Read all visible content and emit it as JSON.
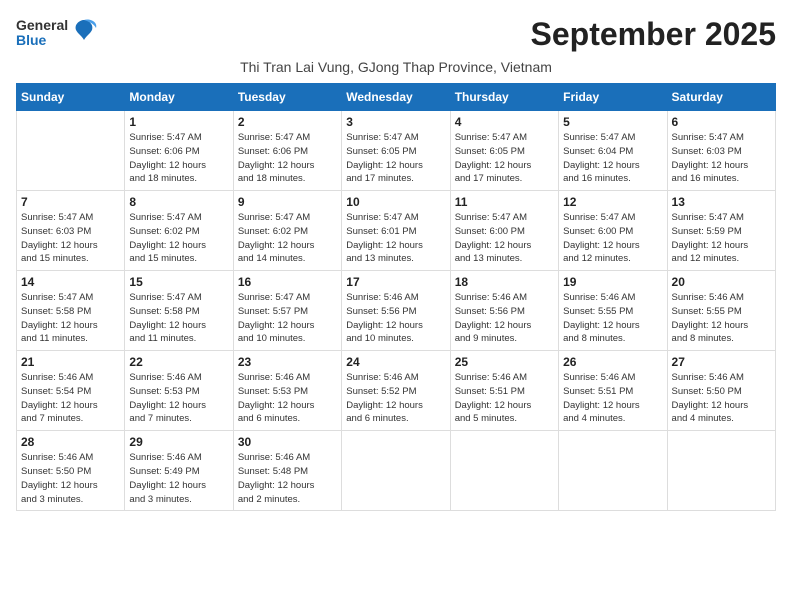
{
  "logo": {
    "general": "General",
    "blue": "Blue"
  },
  "title": "September 2025",
  "subtitle": "Thi Tran Lai Vung, GJong Thap Province, Vietnam",
  "headers": [
    "Sunday",
    "Monday",
    "Tuesday",
    "Wednesday",
    "Thursday",
    "Friday",
    "Saturday"
  ],
  "weeks": [
    [
      {
        "day": "",
        "info": ""
      },
      {
        "day": "1",
        "info": "Sunrise: 5:47 AM\nSunset: 6:06 PM\nDaylight: 12 hours\nand 18 minutes."
      },
      {
        "day": "2",
        "info": "Sunrise: 5:47 AM\nSunset: 6:06 PM\nDaylight: 12 hours\nand 18 minutes."
      },
      {
        "day": "3",
        "info": "Sunrise: 5:47 AM\nSunset: 6:05 PM\nDaylight: 12 hours\nand 17 minutes."
      },
      {
        "day": "4",
        "info": "Sunrise: 5:47 AM\nSunset: 6:05 PM\nDaylight: 12 hours\nand 17 minutes."
      },
      {
        "day": "5",
        "info": "Sunrise: 5:47 AM\nSunset: 6:04 PM\nDaylight: 12 hours\nand 16 minutes."
      },
      {
        "day": "6",
        "info": "Sunrise: 5:47 AM\nSunset: 6:03 PM\nDaylight: 12 hours\nand 16 minutes."
      }
    ],
    [
      {
        "day": "7",
        "info": "Sunrise: 5:47 AM\nSunset: 6:03 PM\nDaylight: 12 hours\nand 15 minutes."
      },
      {
        "day": "8",
        "info": "Sunrise: 5:47 AM\nSunset: 6:02 PM\nDaylight: 12 hours\nand 15 minutes."
      },
      {
        "day": "9",
        "info": "Sunrise: 5:47 AM\nSunset: 6:02 PM\nDaylight: 12 hours\nand 14 minutes."
      },
      {
        "day": "10",
        "info": "Sunrise: 5:47 AM\nSunset: 6:01 PM\nDaylight: 12 hours\nand 13 minutes."
      },
      {
        "day": "11",
        "info": "Sunrise: 5:47 AM\nSunset: 6:00 PM\nDaylight: 12 hours\nand 13 minutes."
      },
      {
        "day": "12",
        "info": "Sunrise: 5:47 AM\nSunset: 6:00 PM\nDaylight: 12 hours\nand 12 minutes."
      },
      {
        "day": "13",
        "info": "Sunrise: 5:47 AM\nSunset: 5:59 PM\nDaylight: 12 hours\nand 12 minutes."
      }
    ],
    [
      {
        "day": "14",
        "info": "Sunrise: 5:47 AM\nSunset: 5:58 PM\nDaylight: 12 hours\nand 11 minutes."
      },
      {
        "day": "15",
        "info": "Sunrise: 5:47 AM\nSunset: 5:58 PM\nDaylight: 12 hours\nand 11 minutes."
      },
      {
        "day": "16",
        "info": "Sunrise: 5:47 AM\nSunset: 5:57 PM\nDaylight: 12 hours\nand 10 minutes."
      },
      {
        "day": "17",
        "info": "Sunrise: 5:46 AM\nSunset: 5:56 PM\nDaylight: 12 hours\nand 10 minutes."
      },
      {
        "day": "18",
        "info": "Sunrise: 5:46 AM\nSunset: 5:56 PM\nDaylight: 12 hours\nand 9 minutes."
      },
      {
        "day": "19",
        "info": "Sunrise: 5:46 AM\nSunset: 5:55 PM\nDaylight: 12 hours\nand 8 minutes."
      },
      {
        "day": "20",
        "info": "Sunrise: 5:46 AM\nSunset: 5:55 PM\nDaylight: 12 hours\nand 8 minutes."
      }
    ],
    [
      {
        "day": "21",
        "info": "Sunrise: 5:46 AM\nSunset: 5:54 PM\nDaylight: 12 hours\nand 7 minutes."
      },
      {
        "day": "22",
        "info": "Sunrise: 5:46 AM\nSunset: 5:53 PM\nDaylight: 12 hours\nand 7 minutes."
      },
      {
        "day": "23",
        "info": "Sunrise: 5:46 AM\nSunset: 5:53 PM\nDaylight: 12 hours\nand 6 minutes."
      },
      {
        "day": "24",
        "info": "Sunrise: 5:46 AM\nSunset: 5:52 PM\nDaylight: 12 hours\nand 6 minutes."
      },
      {
        "day": "25",
        "info": "Sunrise: 5:46 AM\nSunset: 5:51 PM\nDaylight: 12 hours\nand 5 minutes."
      },
      {
        "day": "26",
        "info": "Sunrise: 5:46 AM\nSunset: 5:51 PM\nDaylight: 12 hours\nand 4 minutes."
      },
      {
        "day": "27",
        "info": "Sunrise: 5:46 AM\nSunset: 5:50 PM\nDaylight: 12 hours\nand 4 minutes."
      }
    ],
    [
      {
        "day": "28",
        "info": "Sunrise: 5:46 AM\nSunset: 5:50 PM\nDaylight: 12 hours\nand 3 minutes."
      },
      {
        "day": "29",
        "info": "Sunrise: 5:46 AM\nSunset: 5:49 PM\nDaylight: 12 hours\nand 3 minutes."
      },
      {
        "day": "30",
        "info": "Sunrise: 5:46 AM\nSunset: 5:48 PM\nDaylight: 12 hours\nand 2 minutes."
      },
      {
        "day": "",
        "info": ""
      },
      {
        "day": "",
        "info": ""
      },
      {
        "day": "",
        "info": ""
      },
      {
        "day": "",
        "info": ""
      }
    ]
  ]
}
